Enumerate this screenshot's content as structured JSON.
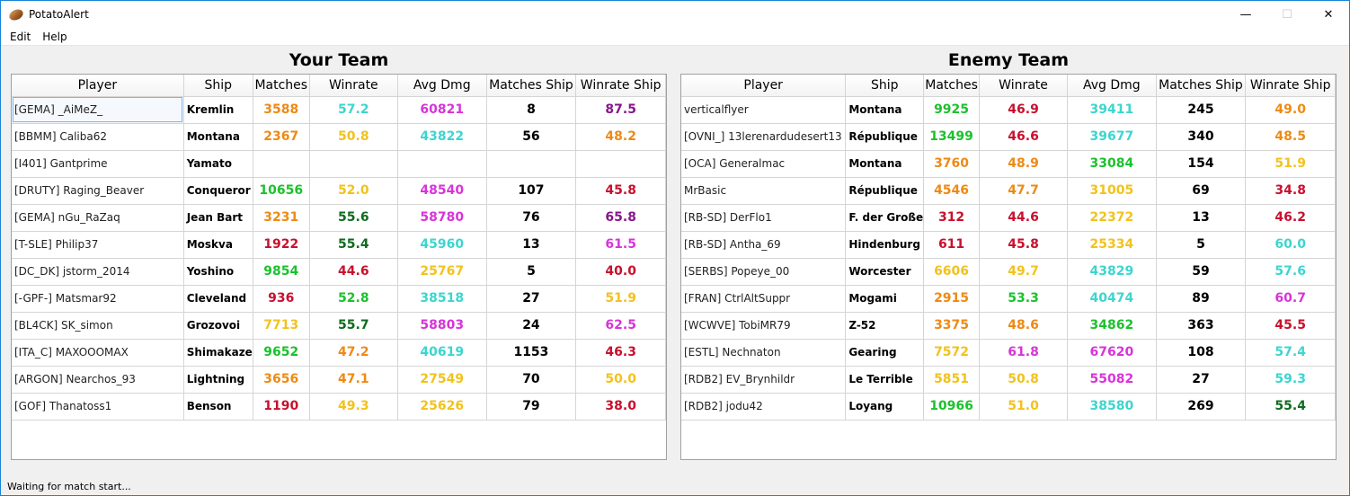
{
  "window": {
    "title": "PotatoAlert",
    "minimize": "—",
    "maximize": "☐",
    "close": "✕"
  },
  "menu": {
    "edit": "Edit",
    "help": "Help"
  },
  "columns": [
    "Player",
    "Ship",
    "Matches",
    "Winrate",
    "Avg Dmg",
    "Matches Ship",
    "Winrate Ship"
  ],
  "colors": {
    "red": "#c8102e",
    "orange": "#ee8a14",
    "yellow": "#f2c21d",
    "green": "#1cc12d",
    "darkgreen": "#0f6b1f",
    "cyan": "#3dd5cf",
    "magenta": "#d734d9",
    "purple": "#86168b",
    "black": "#000000"
  },
  "your_team": {
    "title": "Your Team",
    "rows": [
      {
        "player": "[GEMA] _AiMeZ_",
        "ship": "Kremlin",
        "matches": [
          "3588",
          "orange"
        ],
        "winrate": [
          "57.2",
          "cyan"
        ],
        "avg_dmg": [
          "60821",
          "magenta"
        ],
        "matches_ship": [
          "8",
          "black"
        ],
        "winrate_ship": [
          "87.5",
          "purple"
        ]
      },
      {
        "player": "[BBMM] Caliba62",
        "ship": "Montana",
        "matches": [
          "2367",
          "orange"
        ],
        "winrate": [
          "50.8",
          "yellow"
        ],
        "avg_dmg": [
          "43822",
          "cyan"
        ],
        "matches_ship": [
          "56",
          "black"
        ],
        "winrate_ship": [
          "48.2",
          "orange"
        ]
      },
      {
        "player": "[I401] Gantprime",
        "ship": "Yamato",
        "matches": [
          "",
          "black"
        ],
        "winrate": [
          "",
          "black"
        ],
        "avg_dmg": [
          "",
          "black"
        ],
        "matches_ship": [
          "",
          "black"
        ],
        "winrate_ship": [
          "",
          "black"
        ]
      },
      {
        "player": "[DRUTY] Raging_Beaver",
        "ship": "Conqueror",
        "matches": [
          "10656",
          "green"
        ],
        "winrate": [
          "52.0",
          "yellow"
        ],
        "avg_dmg": [
          "48540",
          "magenta"
        ],
        "matches_ship": [
          "107",
          "black"
        ],
        "winrate_ship": [
          "45.8",
          "red"
        ]
      },
      {
        "player": "[GEMA] nGu_RaZaq",
        "ship": "Jean Bart",
        "matches": [
          "3231",
          "orange"
        ],
        "winrate": [
          "55.6",
          "darkgreen"
        ],
        "avg_dmg": [
          "58780",
          "magenta"
        ],
        "matches_ship": [
          "76",
          "black"
        ],
        "winrate_ship": [
          "65.8",
          "purple"
        ]
      },
      {
        "player": "[T-SLE] Philip37",
        "ship": "Moskva",
        "matches": [
          "1922",
          "red"
        ],
        "winrate": [
          "55.4",
          "darkgreen"
        ],
        "avg_dmg": [
          "45960",
          "cyan"
        ],
        "matches_ship": [
          "13",
          "black"
        ],
        "winrate_ship": [
          "61.5",
          "magenta"
        ]
      },
      {
        "player": "[DC_DK] jstorm_2014",
        "ship": "Yoshino",
        "matches": [
          "9854",
          "green"
        ],
        "winrate": [
          "44.6",
          "red"
        ],
        "avg_dmg": [
          "25767",
          "yellow"
        ],
        "matches_ship": [
          "5",
          "black"
        ],
        "winrate_ship": [
          "40.0",
          "red"
        ]
      },
      {
        "player": "[-GPF-] Matsmar92",
        "ship": "Cleveland",
        "matches": [
          "936",
          "red"
        ],
        "winrate": [
          "52.8",
          "green"
        ],
        "avg_dmg": [
          "38518",
          "cyan"
        ],
        "matches_ship": [
          "27",
          "black"
        ],
        "winrate_ship": [
          "51.9",
          "yellow"
        ]
      },
      {
        "player": "[BL4CK] SK_simon",
        "ship": "Grozovoi",
        "matches": [
          "7713",
          "yellow"
        ],
        "winrate": [
          "55.7",
          "darkgreen"
        ],
        "avg_dmg": [
          "58803",
          "magenta"
        ],
        "matches_ship": [
          "24",
          "black"
        ],
        "winrate_ship": [
          "62.5",
          "magenta"
        ]
      },
      {
        "player": "[ITA_C] MAXOOOMAX",
        "ship": "Shimakaze",
        "matches": [
          "9652",
          "green"
        ],
        "winrate": [
          "47.2",
          "orange"
        ],
        "avg_dmg": [
          "40619",
          "cyan"
        ],
        "matches_ship": [
          "1153",
          "black"
        ],
        "winrate_ship": [
          "46.3",
          "red"
        ]
      },
      {
        "player": "[ARGON] Nearchos_93",
        "ship": "Lightning",
        "matches": [
          "3656",
          "orange"
        ],
        "winrate": [
          "47.1",
          "orange"
        ],
        "avg_dmg": [
          "27549",
          "yellow"
        ],
        "matches_ship": [
          "70",
          "black"
        ],
        "winrate_ship": [
          "50.0",
          "yellow"
        ]
      },
      {
        "player": "[GOF] Thanatoss1",
        "ship": "Benson",
        "matches": [
          "1190",
          "red"
        ],
        "winrate": [
          "49.3",
          "yellow"
        ],
        "avg_dmg": [
          "25626",
          "yellow"
        ],
        "matches_ship": [
          "79",
          "black"
        ],
        "winrate_ship": [
          "38.0",
          "red"
        ]
      }
    ]
  },
  "enemy_team": {
    "title": "Enemy Team",
    "rows": [
      {
        "player": "verticalflyer",
        "ship": "Montana",
        "matches": [
          "9925",
          "green"
        ],
        "winrate": [
          "46.9",
          "red"
        ],
        "avg_dmg": [
          "39411",
          "cyan"
        ],
        "matches_ship": [
          "245",
          "black"
        ],
        "winrate_ship": [
          "49.0",
          "orange"
        ]
      },
      {
        "player": "[OVNI_] 13lerenardudesert13",
        "ship": "République",
        "matches": [
          "13499",
          "green"
        ],
        "winrate": [
          "46.6",
          "red"
        ],
        "avg_dmg": [
          "39677",
          "cyan"
        ],
        "matches_ship": [
          "340",
          "black"
        ],
        "winrate_ship": [
          "48.5",
          "orange"
        ]
      },
      {
        "player": "[OCA] Generalmac",
        "ship": "Montana",
        "matches": [
          "3760",
          "orange"
        ],
        "winrate": [
          "48.9",
          "orange"
        ],
        "avg_dmg": [
          "33084",
          "green"
        ],
        "matches_ship": [
          "154",
          "black"
        ],
        "winrate_ship": [
          "51.9",
          "yellow"
        ]
      },
      {
        "player": "MrBasic",
        "ship": "République",
        "matches": [
          "4546",
          "orange"
        ],
        "winrate": [
          "47.7",
          "orange"
        ],
        "avg_dmg": [
          "31005",
          "yellow"
        ],
        "matches_ship": [
          "69",
          "black"
        ],
        "winrate_ship": [
          "34.8",
          "red"
        ]
      },
      {
        "player": "[RB-SD] DerFlo1",
        "ship": "F. der Große",
        "matches": [
          "312",
          "red"
        ],
        "winrate": [
          "44.6",
          "red"
        ],
        "avg_dmg": [
          "22372",
          "yellow"
        ],
        "matches_ship": [
          "13",
          "black"
        ],
        "winrate_ship": [
          "46.2",
          "red"
        ]
      },
      {
        "player": "[RB-SD] Antha_69",
        "ship": "Hindenburg",
        "matches": [
          "611",
          "red"
        ],
        "winrate": [
          "45.8",
          "red"
        ],
        "avg_dmg": [
          "25334",
          "yellow"
        ],
        "matches_ship": [
          "5",
          "black"
        ],
        "winrate_ship": [
          "60.0",
          "cyan"
        ]
      },
      {
        "player": "[SERBS] Popeye_00",
        "ship": "Worcester",
        "matches": [
          "6606",
          "yellow"
        ],
        "winrate": [
          "49.7",
          "yellow"
        ],
        "avg_dmg": [
          "43829",
          "cyan"
        ],
        "matches_ship": [
          "59",
          "black"
        ],
        "winrate_ship": [
          "57.6",
          "cyan"
        ]
      },
      {
        "player": "[FRAN] CtrlAltSuppr",
        "ship": "Mogami",
        "matches": [
          "2915",
          "orange"
        ],
        "winrate": [
          "53.3",
          "green"
        ],
        "avg_dmg": [
          "40474",
          "cyan"
        ],
        "matches_ship": [
          "89",
          "black"
        ],
        "winrate_ship": [
          "60.7",
          "magenta"
        ]
      },
      {
        "player": "[WCWVE] TobiMR79",
        "ship": "Z-52",
        "matches": [
          "3375",
          "orange"
        ],
        "winrate": [
          "48.6",
          "orange"
        ],
        "avg_dmg": [
          "34862",
          "green"
        ],
        "matches_ship": [
          "363",
          "black"
        ],
        "winrate_ship": [
          "45.5",
          "red"
        ]
      },
      {
        "player": "[ESTL] Nechnaton",
        "ship": "Gearing",
        "matches": [
          "7572",
          "yellow"
        ],
        "winrate": [
          "61.8",
          "magenta"
        ],
        "avg_dmg": [
          "67620",
          "magenta"
        ],
        "matches_ship": [
          "108",
          "black"
        ],
        "winrate_ship": [
          "57.4",
          "cyan"
        ]
      },
      {
        "player": "[RDB2] EV_Brynhildr",
        "ship": "Le Terrible",
        "matches": [
          "5851",
          "yellow"
        ],
        "winrate": [
          "50.8",
          "yellow"
        ],
        "avg_dmg": [
          "55082",
          "magenta"
        ],
        "matches_ship": [
          "27",
          "black"
        ],
        "winrate_ship": [
          "59.3",
          "cyan"
        ]
      },
      {
        "player": "[RDB2] jodu42",
        "ship": "Loyang",
        "matches": [
          "10966",
          "green"
        ],
        "winrate": [
          "51.0",
          "yellow"
        ],
        "avg_dmg": [
          "38580",
          "cyan"
        ],
        "matches_ship": [
          "269",
          "black"
        ],
        "winrate_ship": [
          "55.4",
          "darkgreen"
        ]
      }
    ]
  },
  "status": "Waiting for match start..."
}
